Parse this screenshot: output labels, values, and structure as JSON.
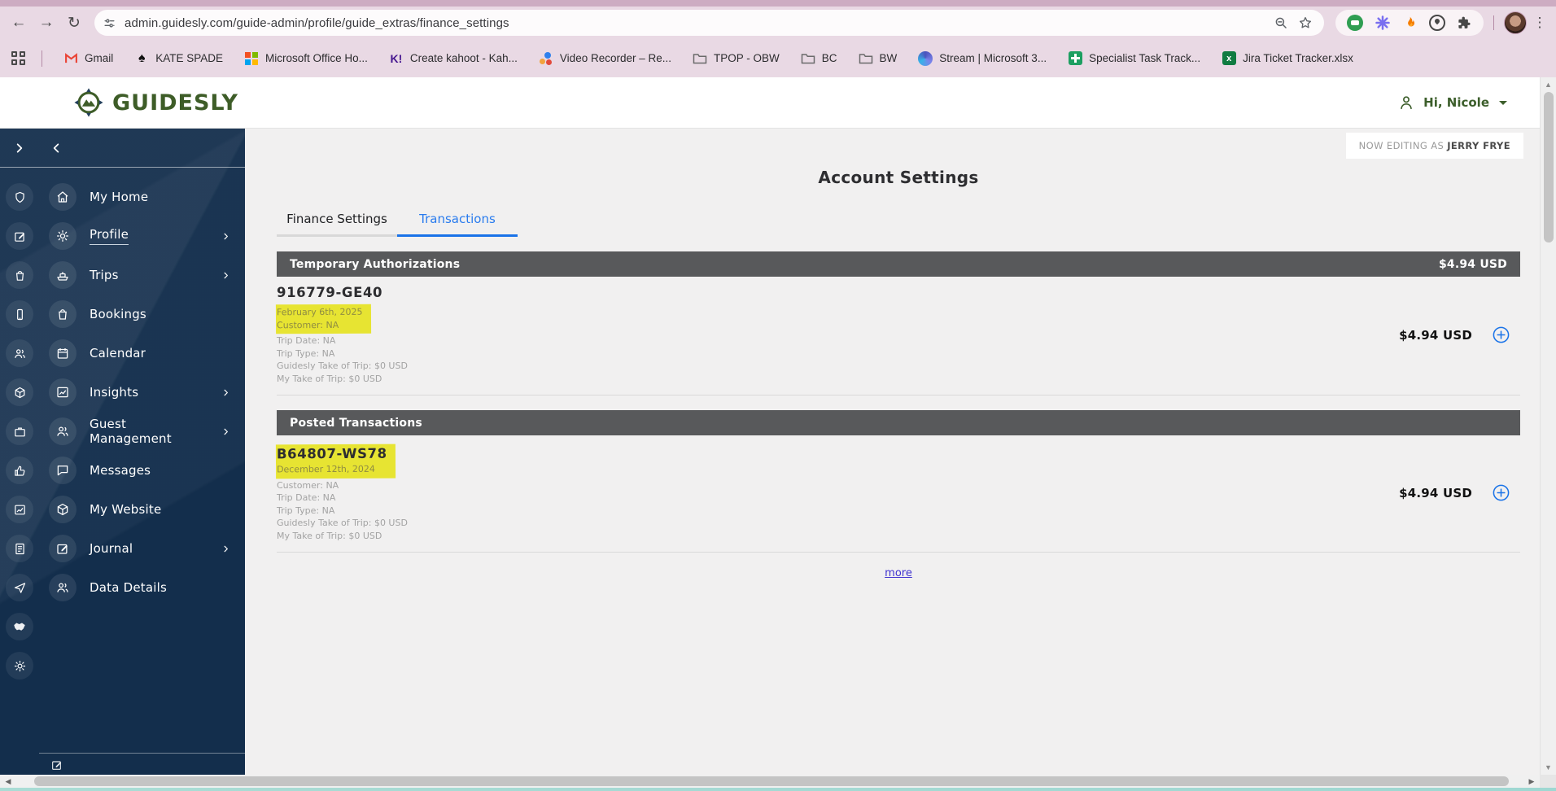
{
  "browser": {
    "url": "admin.guidesly.com/guide-admin/profile/guide_extras/finance_settings",
    "bookmarks": [
      {
        "label": "Gmail"
      },
      {
        "label": "KATE SPADE"
      },
      {
        "label": "Microsoft Office Ho..."
      },
      {
        "label": "Create kahoot - Kah..."
      },
      {
        "label": "Video Recorder – Re..."
      },
      {
        "label": "TPOP - OBW"
      },
      {
        "label": "BC"
      },
      {
        "label": "BW"
      },
      {
        "label": "Stream | Microsoft 3..."
      },
      {
        "label": "Specialist Task Track..."
      },
      {
        "label": "Jira Ticket Tracker.xlsx"
      }
    ]
  },
  "header": {
    "brand": "GUIDESLY",
    "greeting": "Hi, Nicole"
  },
  "editing": {
    "prefix": "NOW EDITING AS",
    "user": "JERRY FRYE"
  },
  "sidebar": {
    "items": [
      {
        "label": "My Home"
      },
      {
        "label": "Profile"
      },
      {
        "label": "Trips"
      },
      {
        "label": "Bookings"
      },
      {
        "label": "Calendar"
      },
      {
        "label": "Insights"
      },
      {
        "label": "Guest Management"
      },
      {
        "label": "Messages"
      },
      {
        "label": "My Website"
      },
      {
        "label": "Journal"
      },
      {
        "label": "Data Details"
      }
    ]
  },
  "main": {
    "title": "Account Settings",
    "tabs": [
      {
        "label": "Finance Settings"
      },
      {
        "label": "Transactions"
      }
    ],
    "active_tab": "Transactions",
    "sections": [
      {
        "title": "Temporary Authorizations",
        "amount": "$4.94 USD",
        "transactions": [
          {
            "id": "916779-GE40",
            "lines": [
              "February 6th, 2025",
              "Customer: NA",
              "Trip Date: NA",
              "Trip Type: NA",
              "Guidesly Take of Trip: $0 USD",
              "My Take of Trip: $0 USD"
            ],
            "amount": "$4.94 USD"
          }
        ]
      },
      {
        "title": "Posted Transactions",
        "amount": "",
        "transactions": [
          {
            "id": "B64807-WS78",
            "lines": [
              "December 12th, 2024",
              "Customer: NA",
              "Trip Date: NA",
              "Trip Type: NA",
              "Guidesly Take of Trip: $0 USD",
              "My Take of Trip: $0 USD"
            ],
            "amount": "$4.94 USD"
          }
        ]
      }
    ],
    "more_label": "more"
  },
  "colors": {
    "accent_green": "#3e5d28",
    "sidebar_navy": "#132e4c",
    "highlight_yellow": "#e7e432",
    "tab_blue": "#2a7cee",
    "section_gray": "#58595b",
    "link_blue": "#4033d0",
    "plus_blue": "#1a73e8",
    "chrome_pink": "#e9d9e4"
  }
}
